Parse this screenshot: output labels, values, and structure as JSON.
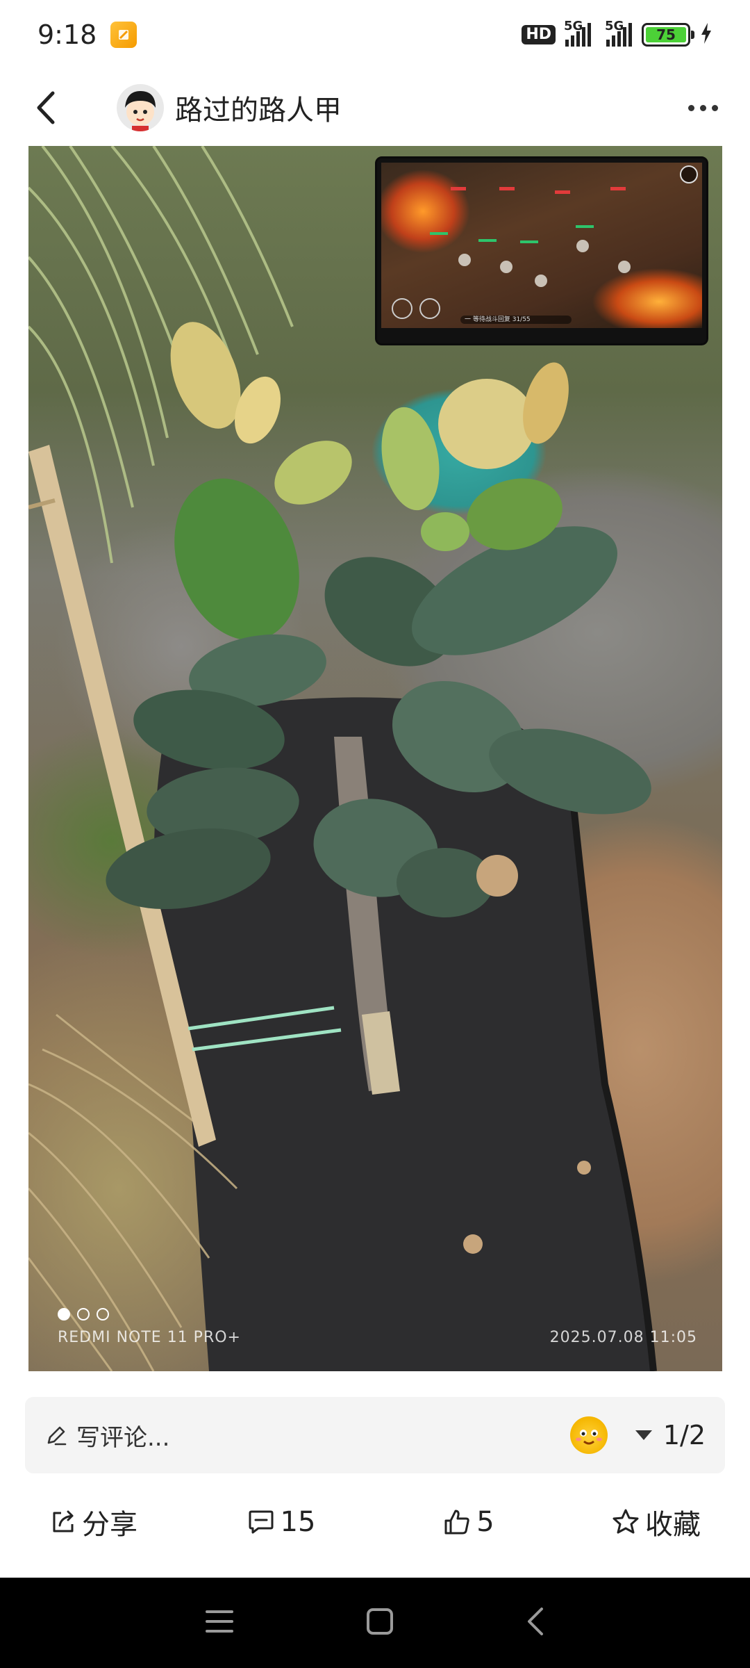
{
  "status_bar": {
    "time": "9:18",
    "network_badge": "HD",
    "sim1_label": "5G",
    "sim2_label": "5G",
    "battery_level": "75"
  },
  "header": {
    "back_icon": "chevron-left-icon",
    "username": "路过的路人甲",
    "more_icon": "more-dots-icon"
  },
  "photo": {
    "camera_watermark": "REDMI NOTE 11 PRO+",
    "timestamp": "2025.07.08  11:05",
    "pager": {
      "current": 1,
      "total": 3
    }
  },
  "pip_video": {
    "caption": "一 等待战斗回复  31/55"
  },
  "comment": {
    "placeholder": "写评论...",
    "emoji_icon": "emoji-face-icon",
    "page_indicator": "1/2"
  },
  "actions": {
    "share": "分享",
    "comments_count": "15",
    "likes_count": "5",
    "favorite": "收藏"
  },
  "colors": {
    "battery_fill": "#4cd137",
    "background": "#ffffff",
    "comment_bg": "#f4f4f4",
    "navbar_bg": "#000000"
  }
}
